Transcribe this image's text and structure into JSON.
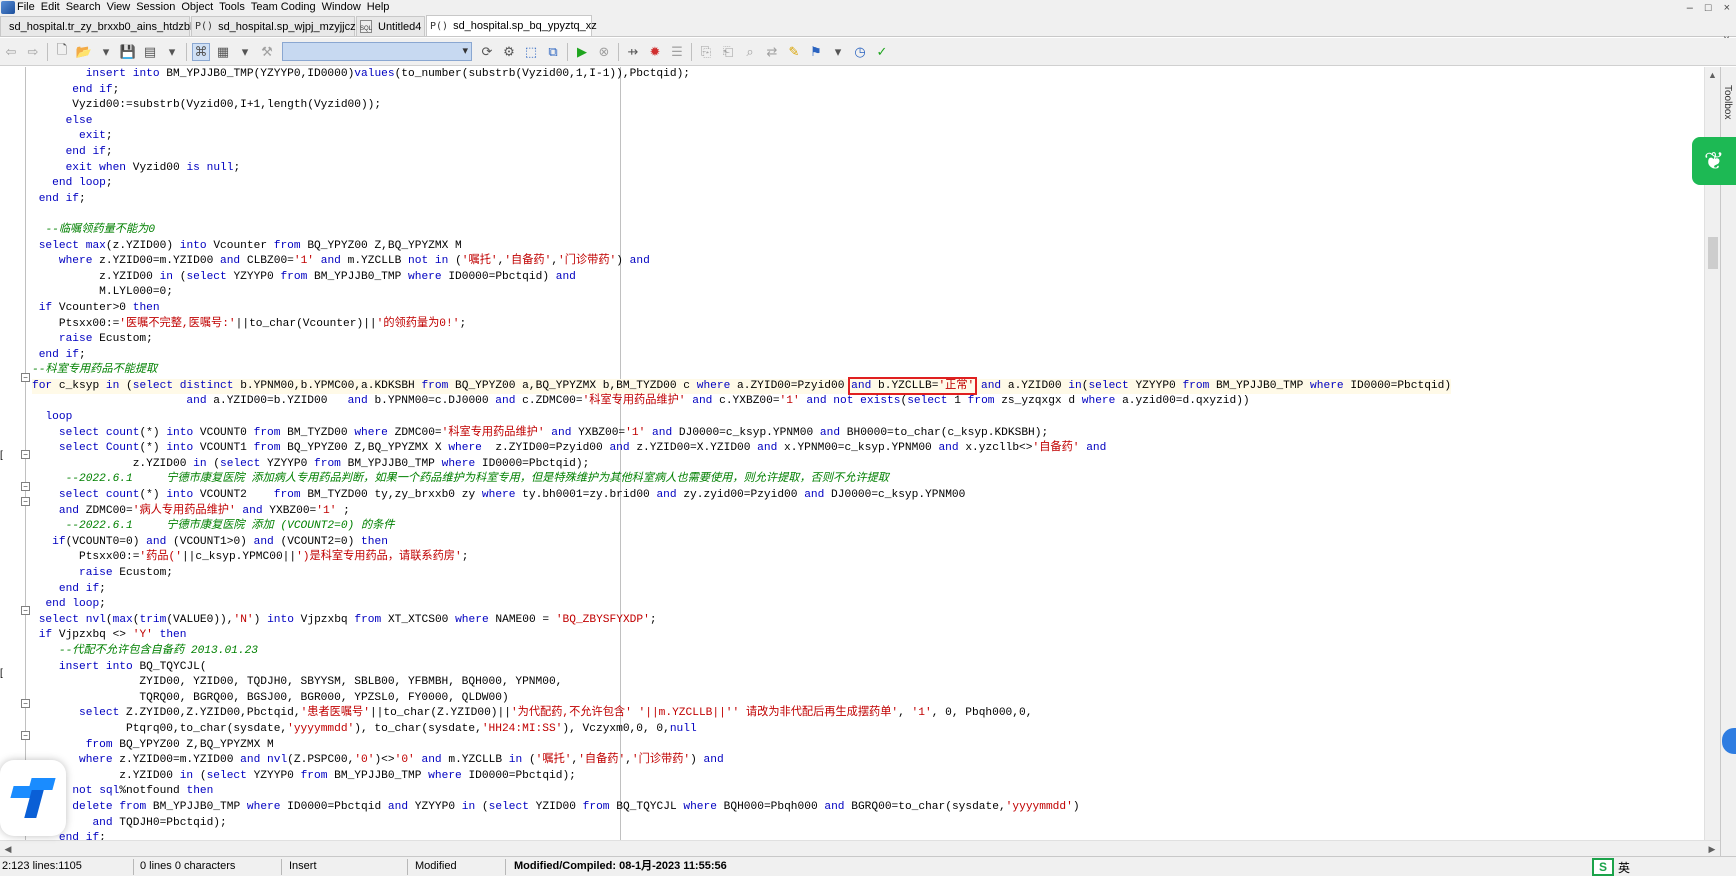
{
  "menu": {
    "items": [
      "File",
      "Edit",
      "Search",
      "View",
      "Session",
      "Object",
      "Tools",
      "Team Coding",
      "Window",
      "Help"
    ],
    "window_controls": [
      "–",
      "□",
      "×"
    ]
  },
  "tabs": [
    {
      "icon": "",
      "label": "sd_hospital.tr_zy_brxxb0_ains_htdzbl"
    },
    {
      "icon": "P()",
      "label": "sd_hospital.sp_wjpj_mzyjjcz"
    },
    {
      "icon": "SQL",
      "label": "Untitled4"
    },
    {
      "icon": "P()",
      "label": "sd_hospital.sp_bq_ypyztq_xz"
    }
  ],
  "tab_close": "×",
  "side": {
    "toolbox_label": "Toolbox"
  },
  "code": [
    "        insert into BM_YPJJB0_TMP(YZYYP0,ID0000)values(to_number(substrb(Vyzid00,1,I-1)),Pbctqid);",
    "      end if;",
    "      Vyzid00:=substrb(Vyzid00,I+1,length(Vyzid00));",
    "     else",
    "       exit;",
    "     end if;",
    "     exit when Vyzid00 is null;",
    "   end loop;",
    " end if;",
    "",
    "  --临嘱领药量不能为0",
    " select max(z.YZID00) into Vcounter from BQ_YPYZ00 Z,BQ_YPYZMX M",
    "    where z.YZID00=m.YZID00 and CLBZ00='1' and m.YZCLLB not in ('嘱托','自备药','门诊带药') and",
    "          z.YZID00 in (select YZYYP0 from BM_YPJJB0_TMP where ID0000=Pbctqid) and",
    "          M.LYL000=0;",
    " if Vcounter>0 then",
    "    Ptsxx00:='医嘱不完整,医嘱号:'||to_char(Vcounter)||'的领药量为0!';",
    "    raise Ecustom;",
    " end if;",
    "--科室专用药品不能提取",
    "for c_ksyp in (select distinct b.YPNM00,b.YPMC00,a.KDKSBH from BQ_YPYZ00 a,BQ_YPYZMX b,BM_TYZD00 c where a.ZYID00=Pzyid00 and b.YZCLLB='正常' and a.YZID00 in(select YZYYP0 from BM_YPJJB0_TMP where ID0000=Pbctqid)",
    "                       and a.YZID00=b.YZID00   and b.YPNM00=c.DJ0000 and c.ZDMC00='科室专用药品维护' and c.YXBZ00='1' and not exists(select 1 from zs_yzqxgx d where a.yzid00=d.qxyzid))",
    "  loop",
    "    select count(*) into VCOUNT0 from BM_TYZD00 where ZDMC00='科室专用药品维护' and YXBZ00='1' and DJ0000=c_ksyp.YPNM00 and BH0000=to_char(c_ksyp.KDKSBH);",
    "    select Count(*) into VCOUNT1 from BQ_YPYZ00 Z,BQ_YPYZMX X where  z.ZYID00=Pzyid00 and z.YZID00=X.YZID00 and x.YPNM00=c_ksyp.YPNM00 and x.yzcllb<>'自备药' and",
    "               z.YZID00 in (select YZYYP0 from BM_YPJJB0_TMP where ID0000=Pbctqid);",
    "     --2022.6.1     宁德市康复医院 添加病人专用药品判断，如果一个药品维护为科室专用，但是特殊维护为其他科室病人也需要使用，则允许提取，否则不允许提取",
    "    select count(*) into VCOUNT2    from BM_TYZD00 ty,zy_brxxb0 zy where ty.bh0001=zy.brid00 and zy.zyid00=Pzyid00 and DJ0000=c_ksyp.YPNM00",
    "    and ZDMC00='病人专用药品维护' and YXBZ00='1' ;",
    "     --2022.6.1     宁德市康复医院 添加 (VCOUNT2=0) 的条件",
    "   if(VCOUNT0=0) and (VCOUNT1>0) and (VCOUNT2=0) then",
    "       Ptsxx00:='药品('||c_ksyp.YPMC00||')是科室专用药品，请联系药房';",
    "       raise Ecustom;",
    "    end if;",
    "  end loop;",
    " select nvl(max(trim(VALUE0)),'N') into Vjpzxbq from XT_XTCS00 where NAME00 = 'BQ_ZBYSFYXDP';",
    " if Vjpzxbq <> 'Y' then",
    "    --代配不允许包含自备药 2013.01.23",
    "    insert into BQ_TQYCJL(",
    "                ZYID00, YZID00, TQDJH0, SBYYSM, SBLB00, YFBMBH, BQH000, YPNM00,",
    "                TQRQ00, BGRQ00, BGSJ00, BGR000, YPZSL0, FY0000, QLDW00)",
    "       select Z.ZYID00,Z.YZID00,Pbctqid,'患者医嘱号'||to_char(Z.YZID00)||'为代配药,不允许包含' '||m.YZCLLB||'' 请改为非代配后再生成摆药单', '1', 0, Pbqh000,0,",
    "              Ptqrq00,to_char(sysdate,'yyyymmdd'), to_char(sysdate,'HH24:MI:SS'), Vczyxm0,0, 0,null",
    "        from BQ_YPYZ00 Z,BQ_YPYZMX M",
    "       where z.YZID00=m.YZID00 and nvl(Z.PSPC00,'0')<>'0' and m.YZCLLB in ('嘱托','自备药','门诊带药') and",
    "             z.YZID00 in (select YZYYP0 from BM_YPJJB0_TMP where ID0000=Pbctqid);",
    "   if not sql%notfound then",
    "      delete from BM_YPJJB0_TMP where ID0000=Pbctqid and YZYYP0 in (select YZID00 from BQ_TQYCJL where BQH000=Pbqh000 and BGRQ00=to_char(sysdate,'yyyymmdd')",
    "         and TQDJH0=Pbctqid);",
    "    end if;"
  ],
  "highlight_text": "and b.YZCLLB='正常'",
  "status": {
    "position": "2:123 lines:1105",
    "selection": "0 lines 0 characters",
    "mode": "Insert",
    "state": "Modified",
    "compiled": "Modified/Compiled: 08-1月-2023 11:55:56",
    "tray_text": "英"
  },
  "colors": {
    "keyword": "#0000c0",
    "comment": "#008000",
    "string": "#c00000",
    "highlight_box": "#e02020",
    "toolbar_combo": "#c7d9f1",
    "side_app": "#1db954"
  }
}
